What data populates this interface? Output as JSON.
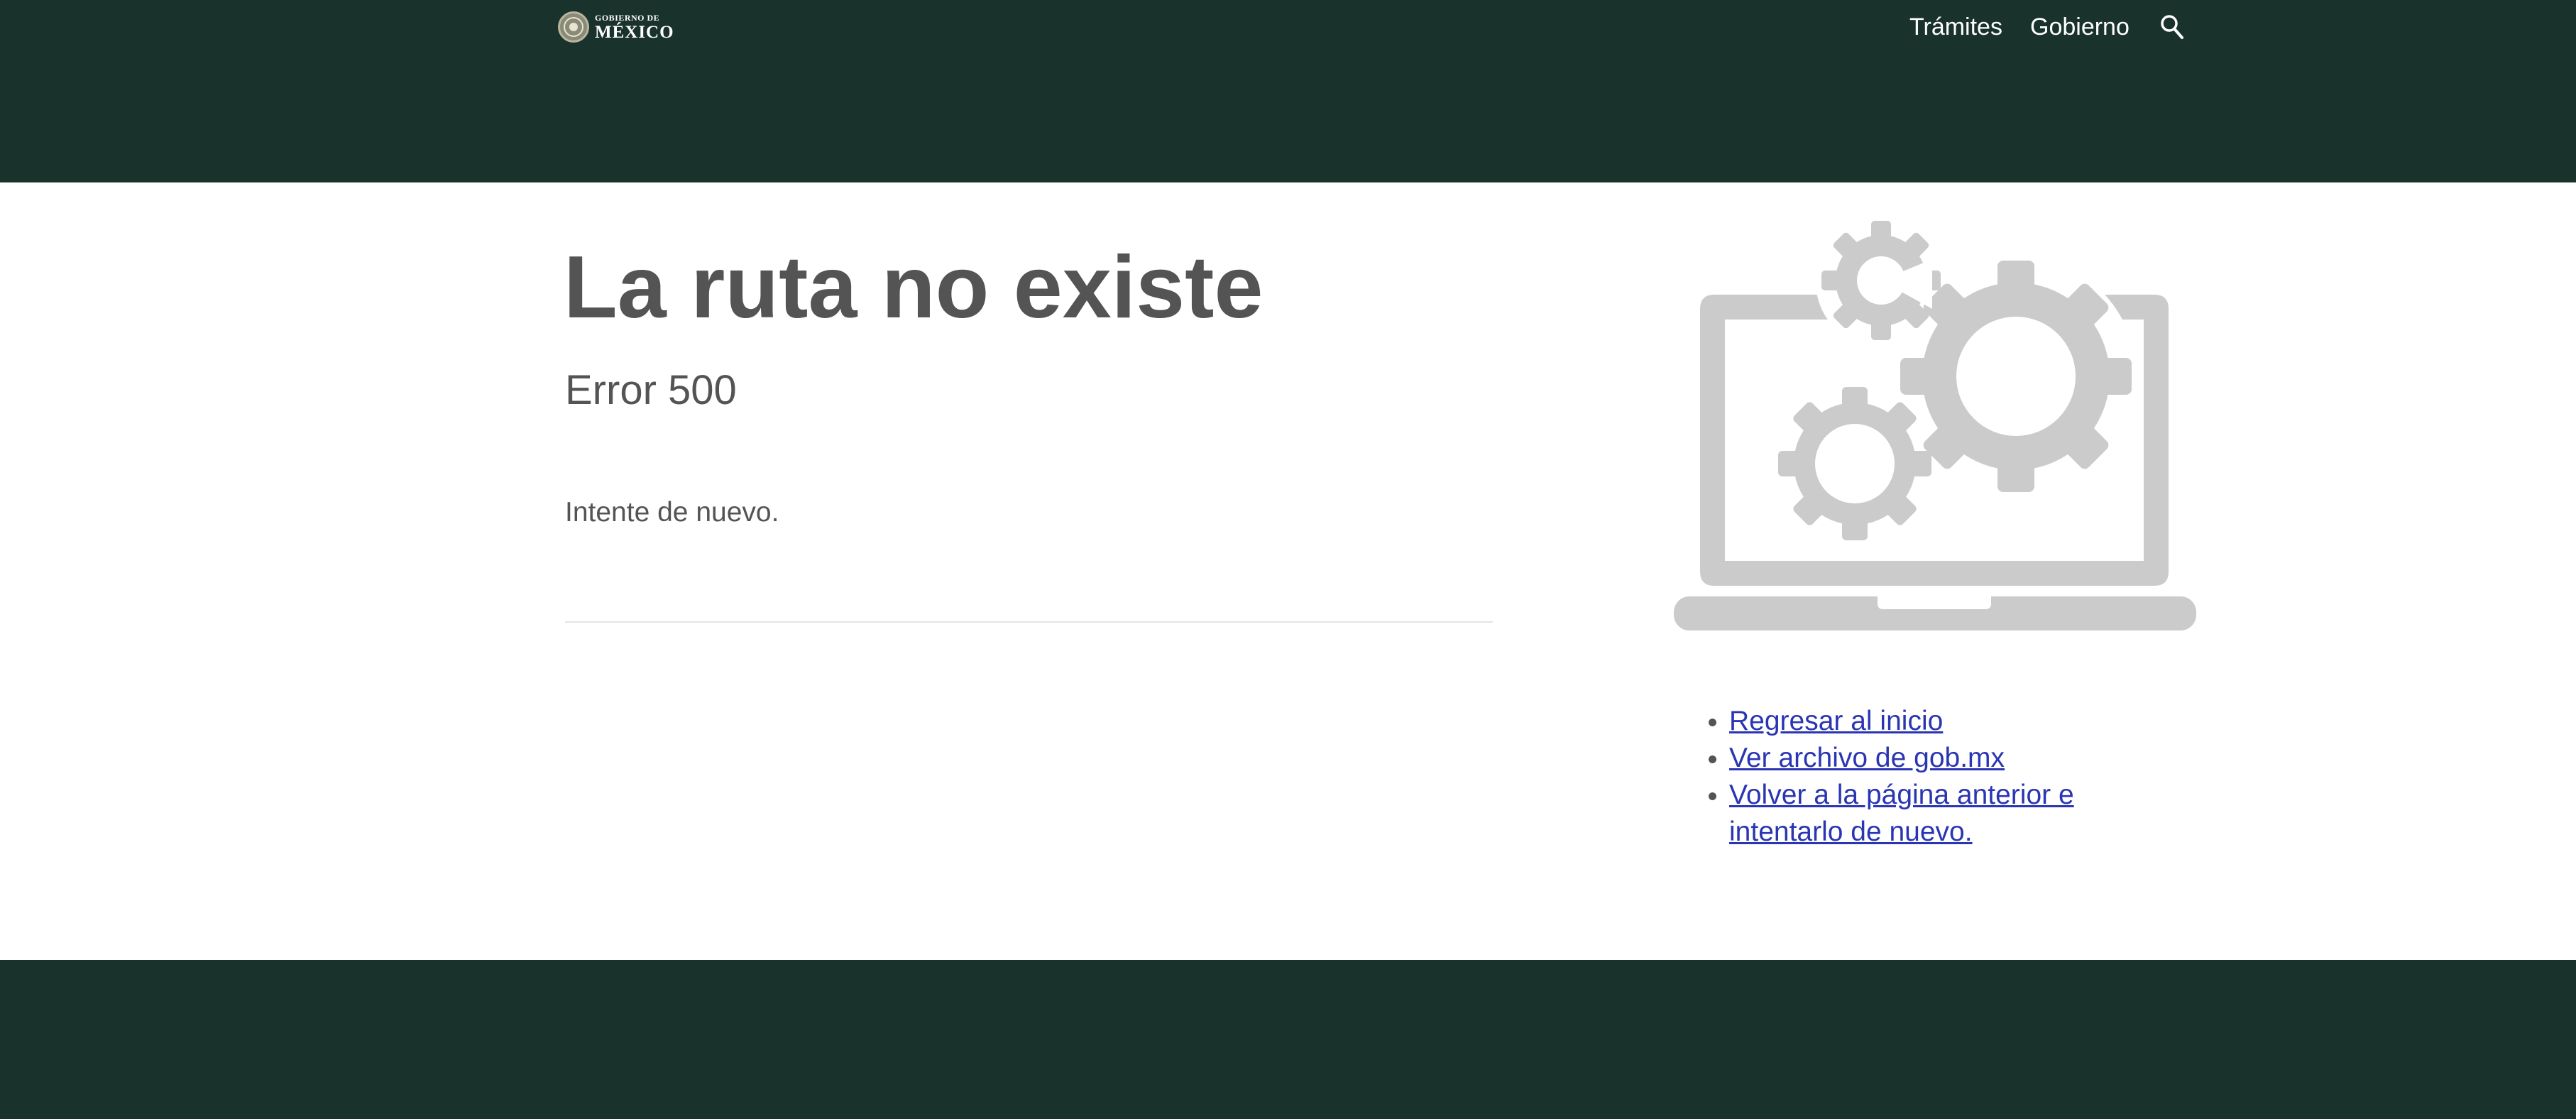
{
  "header": {
    "logo": {
      "line1": "GOBIERNO DE",
      "line2": "MÉXICO"
    },
    "nav": {
      "tramites": "Trámites",
      "gobierno": "Gobierno",
      "search_icon": "search-icon"
    }
  },
  "main": {
    "title": "La ruta no existe",
    "error_code": "Error 500",
    "message": "Intente de nuevo."
  },
  "illustration": {
    "icon": "laptop-gears-icon",
    "color": "#cbcbcb"
  },
  "links": [
    {
      "label": "Regresar al inicio"
    },
    {
      "label": "Ver archivo de gob.mx"
    },
    {
      "label": "Volver a la página anterior e intentarlo de nuevo."
    }
  ],
  "colors": {
    "header_bg": "#1a322c",
    "footer_bg": "#1a322c",
    "text": "#545454",
    "link": "#2a35b4"
  }
}
